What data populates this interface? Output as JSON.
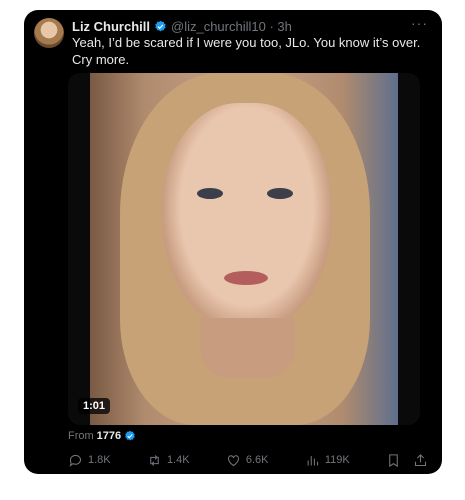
{
  "tweet": {
    "author_name": "Liz Churchill",
    "handle_time": "@liz_churchill10 · 3h",
    "more_label": "···",
    "text": "Yeah, I’d be scared if I were you too, JLo. You know it’s over. Cry more.",
    "video_duration": "1:01",
    "attribution_prefix": "From",
    "attribution_source": "1776",
    "actions": {
      "replies": "1.8K",
      "retweets": "1.4K",
      "likes": "6.6K",
      "views": "119K"
    },
    "colors": {
      "background": "#000000",
      "text": "#e7e9ea",
      "muted": "#71767b",
      "verified": "#1d9bf0"
    }
  },
  "icons": [
    "verified-badge-icon",
    "reply-icon",
    "retweet-icon",
    "like-icon",
    "views-icon",
    "bookmark-icon",
    "share-icon"
  ]
}
